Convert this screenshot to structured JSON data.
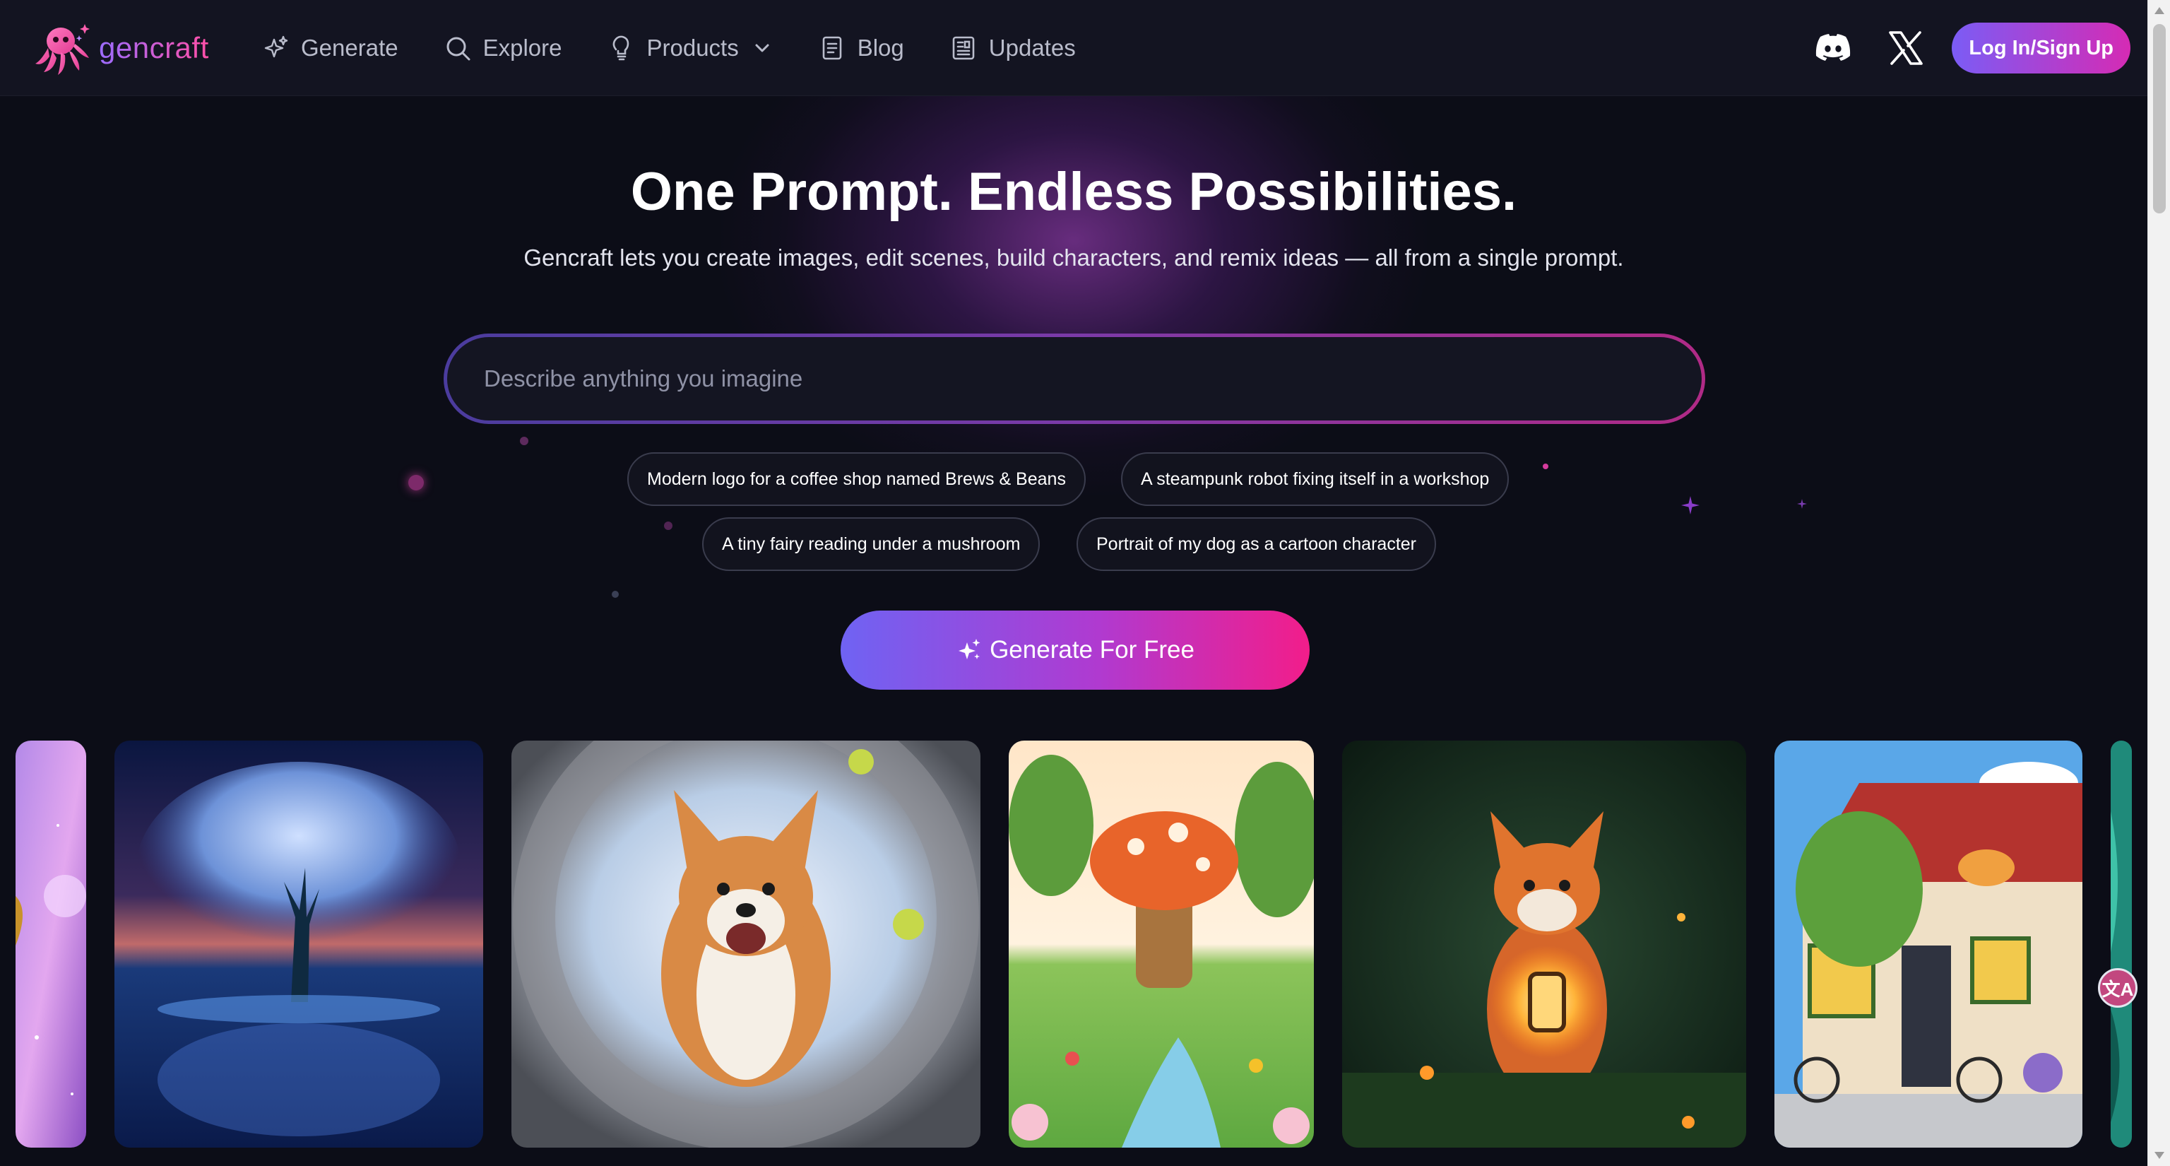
{
  "brand": {
    "name": "gencraft"
  },
  "nav": {
    "items": [
      {
        "label": "Generate",
        "icon": "sparkles-icon"
      },
      {
        "label": "Explore",
        "icon": "search-icon"
      },
      {
        "label": "Products",
        "icon": "lightbulb-icon"
      },
      {
        "label": "Blog",
        "icon": "document-icon"
      },
      {
        "label": "Updates",
        "icon": "news-icon"
      }
    ],
    "login_label": "Log In/Sign Up"
  },
  "hero": {
    "title": "One Prompt. Endless Possibilities.",
    "subtitle": "Gencraft lets you create images, edit scenes, build characters, and remix ideas — all from a single prompt.",
    "prompt_placeholder": "Describe anything you imagine",
    "suggestions": [
      "Modern logo for a coffee shop named Brews & Beans",
      "A steampunk robot fixing itself in a workshop",
      "A tiny fairy reading under a mushroom",
      "Portrait of my dog as a cartoon character"
    ],
    "cta_label": "Generate For Free"
  },
  "gallery": [
    {
      "subject": "purple-galaxy-artwork"
    },
    {
      "subject": "crystal-tree-reflection"
    },
    {
      "subject": "corgi-in-space-porthole"
    },
    {
      "subject": "mushroom-house-meadow"
    },
    {
      "subject": "fox-with-lantern"
    },
    {
      "subject": "cottage-with-cat-on-roof"
    },
    {
      "subject": "teal-abstract-artwork"
    }
  ],
  "colors": {
    "background": "#0c0d17",
    "topbar": "#131421",
    "accent_purple": "#7b5cf5",
    "accent_pink": "#f21d8a"
  },
  "translate_badge": "文A"
}
